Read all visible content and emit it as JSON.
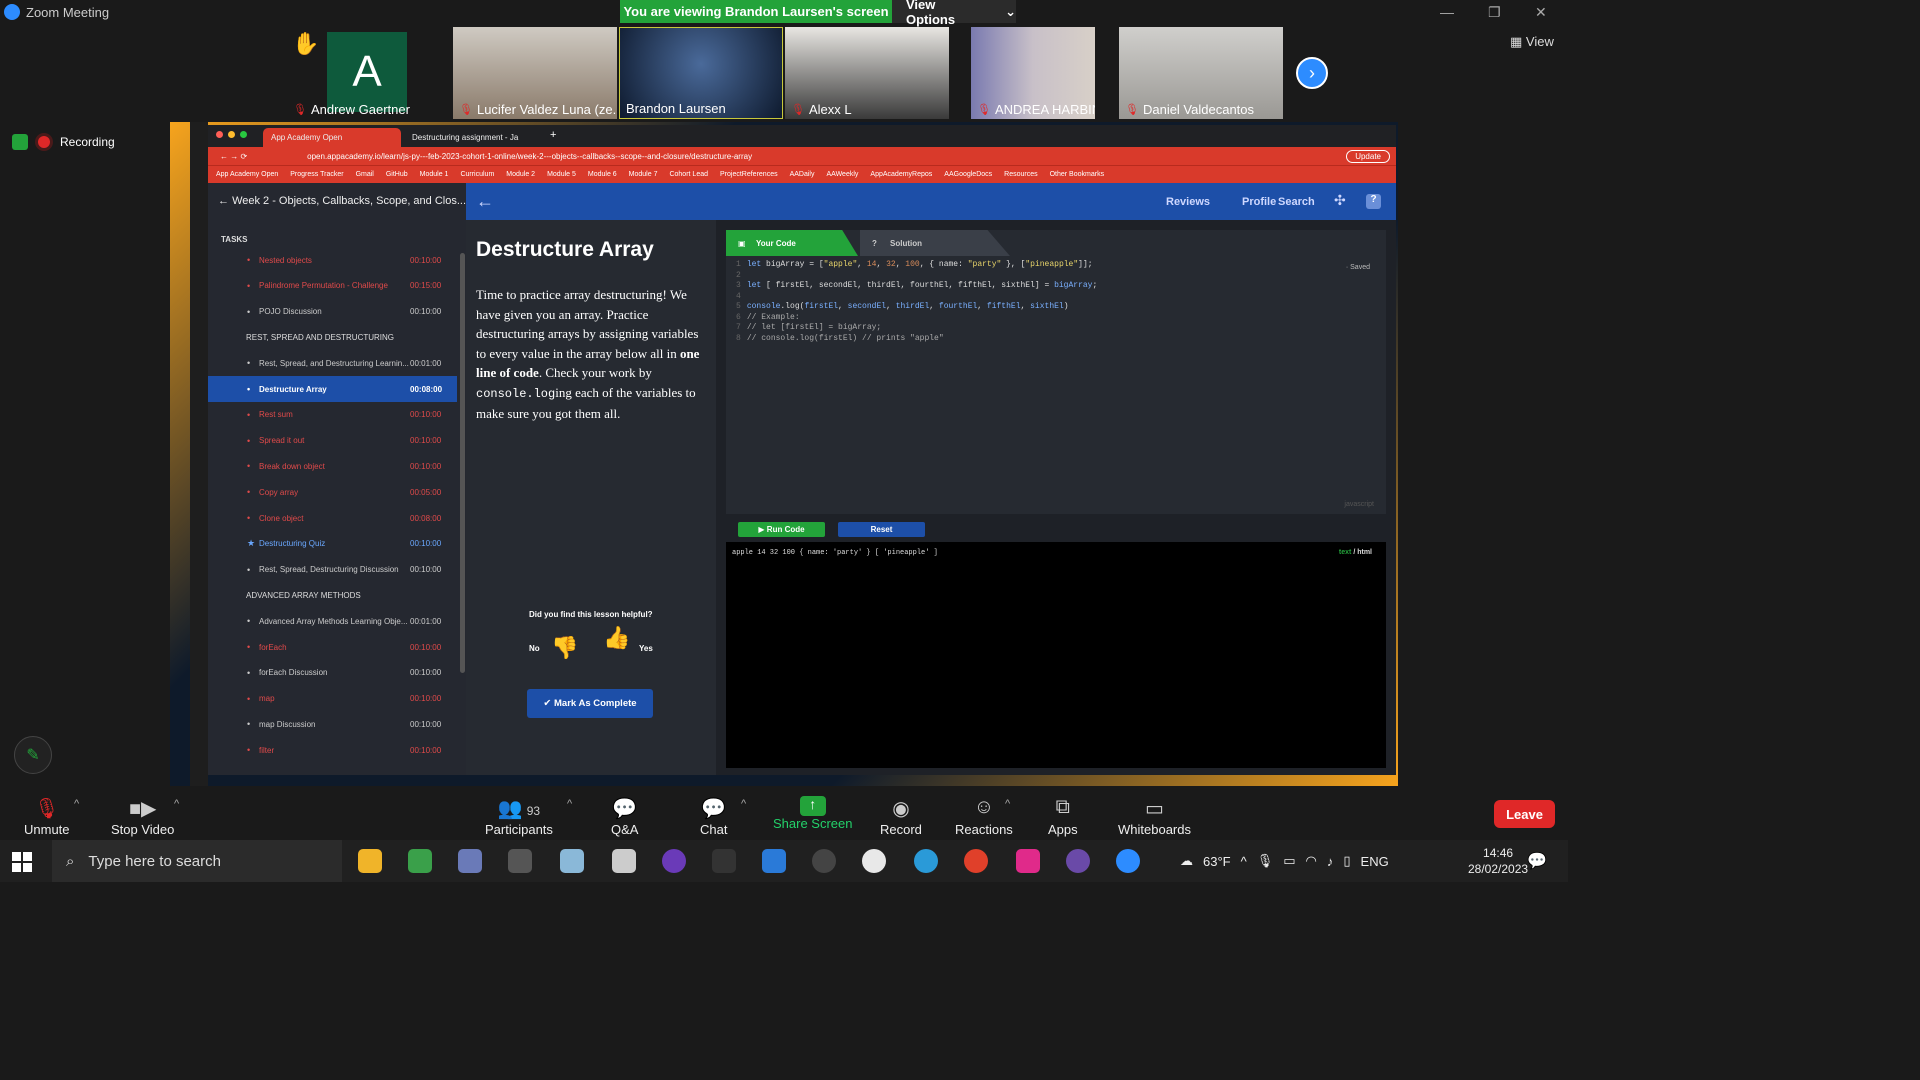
{
  "zoom": {
    "title": "Zoom Meeting",
    "banner": "You are viewing Brandon Laursen's screen",
    "view_options": "View Options",
    "view_button": "View",
    "recording": "Recording",
    "participants": [
      {
        "name": "Andrew Gaertner",
        "muted": true,
        "avatar": "A",
        "hand_raised": true
      },
      {
        "name": "Lucifer Valdez Luna (ze...",
        "muted": true
      },
      {
        "name": "Brandon Laursen",
        "muted": false,
        "active": true
      },
      {
        "name": "Alexx L",
        "muted": true
      },
      {
        "name": "ANDREA HARBIN",
        "muted": true
      },
      {
        "name": "Daniel Valdecantos",
        "muted": true
      }
    ],
    "controls": {
      "unmute": "Unmute",
      "stop_video": "Stop Video",
      "participants": "Participants",
      "participants_count": "93",
      "qa": "Q&A",
      "chat": "Chat",
      "share_screen": "Share Screen",
      "record": "Record",
      "reactions": "Reactions",
      "apps": "Apps",
      "whiteboards": "Whiteboards",
      "leave": "Leave"
    }
  },
  "browser": {
    "tabs": [
      "App Academy Open",
      "Destructuring assignment - Ja"
    ],
    "url": "open.appacademy.io/learn/js-py---feb-2023-cohort-1-online/week-2---objects--callbacks--scope--and-closure/destructure-array",
    "update": "Update",
    "bookmarks": [
      "App Academy Open",
      "Progress Tracker",
      "Gmail",
      "GitHub",
      "Module 1",
      "Curriculum",
      "Module 2",
      "Module 5",
      "Module 6",
      "Module 7",
      "Cohort Lead",
      "ProjectReferences",
      "AADaily",
      "AAWeekly",
      "AppAcademyRepos",
      "AAGoogleDocs",
      "Resources",
      "Other Bookmarks"
    ]
  },
  "aa": {
    "nav": {
      "reviews": "Reviews",
      "profile": "Profile",
      "search": "Search"
    },
    "week_title": "Week 2 - Objects, Callbacks, Scope, and Clos...",
    "tasks_label": "TASKS",
    "tasks": [
      {
        "label": "Nested objects",
        "time": "00:10:00",
        "status": "red"
      },
      {
        "label": "Palindrome Permutation - Challenge",
        "time": "00:15:00",
        "status": "red"
      },
      {
        "label": "POJO Discussion",
        "time": "00:10:00",
        "status": "grey"
      },
      {
        "section": "REST, SPREAD AND DESTRUCTURING"
      },
      {
        "label": "Rest, Spread, and Destructuring Learnin...",
        "time": "00:01:00",
        "status": "grey"
      },
      {
        "label": "Destructure Array",
        "time": "00:08:00",
        "status": "active"
      },
      {
        "label": "Rest sum",
        "time": "00:10:00",
        "status": "red"
      },
      {
        "label": "Spread it out",
        "time": "00:10:00",
        "status": "red"
      },
      {
        "label": "Break down object",
        "time": "00:10:00",
        "status": "red"
      },
      {
        "label": "Copy array",
        "time": "00:05:00",
        "status": "red"
      },
      {
        "label": "Clone object",
        "time": "00:08:00",
        "status": "red"
      },
      {
        "label": "Destructuring Quiz",
        "time": "00:10:00",
        "status": "quiz"
      },
      {
        "label": "Rest, Spread, Destructuring Discussion",
        "time": "00:10:00",
        "status": "grey"
      },
      {
        "section": "ADVANCED ARRAY METHODS"
      },
      {
        "label": "Advanced Array Methods Learning Obje...",
        "time": "00:01:00",
        "status": "grey"
      },
      {
        "label": "forEach",
        "time": "00:10:00",
        "status": "red"
      },
      {
        "label": "forEach Discussion",
        "time": "00:10:00",
        "status": "grey"
      },
      {
        "label": "map",
        "time": "00:10:00",
        "status": "red"
      },
      {
        "label": "map Discussion",
        "time": "00:10:00",
        "status": "grey"
      },
      {
        "label": "filter",
        "time": "00:10:00",
        "status": "red"
      }
    ],
    "lesson": {
      "title": "Destructure Array",
      "p1": "Time to practice array destructuring! We have given you an array. Practice destructuring arrays by assigning variables to every value in the array below all in ",
      "bold": "one line of code",
      "p2": ". Check your work by ",
      "code": "console.log",
      "p3": "ing each of the variables to make sure you got them all.",
      "helpful": "Did you find this lesson helpful?",
      "no": "No",
      "yes": "Yes",
      "complete": "✔ Mark As Complete"
    },
    "editor": {
      "tab_code": "Your Code",
      "tab_solution": "Solution",
      "saved": "Saved",
      "language": "javascript",
      "run": "▶ Run Code",
      "reset": "Reset",
      "output": "apple 14 32 100 { name: 'party' } [ 'pineapple' ]",
      "mode_text": "text",
      "mode_html": "html"
    }
  },
  "taskbar": {
    "search_placeholder": "Type here to search",
    "weather": "63°F",
    "lang": "ENG",
    "time": "14:46",
    "date": "28/02/2023"
  }
}
